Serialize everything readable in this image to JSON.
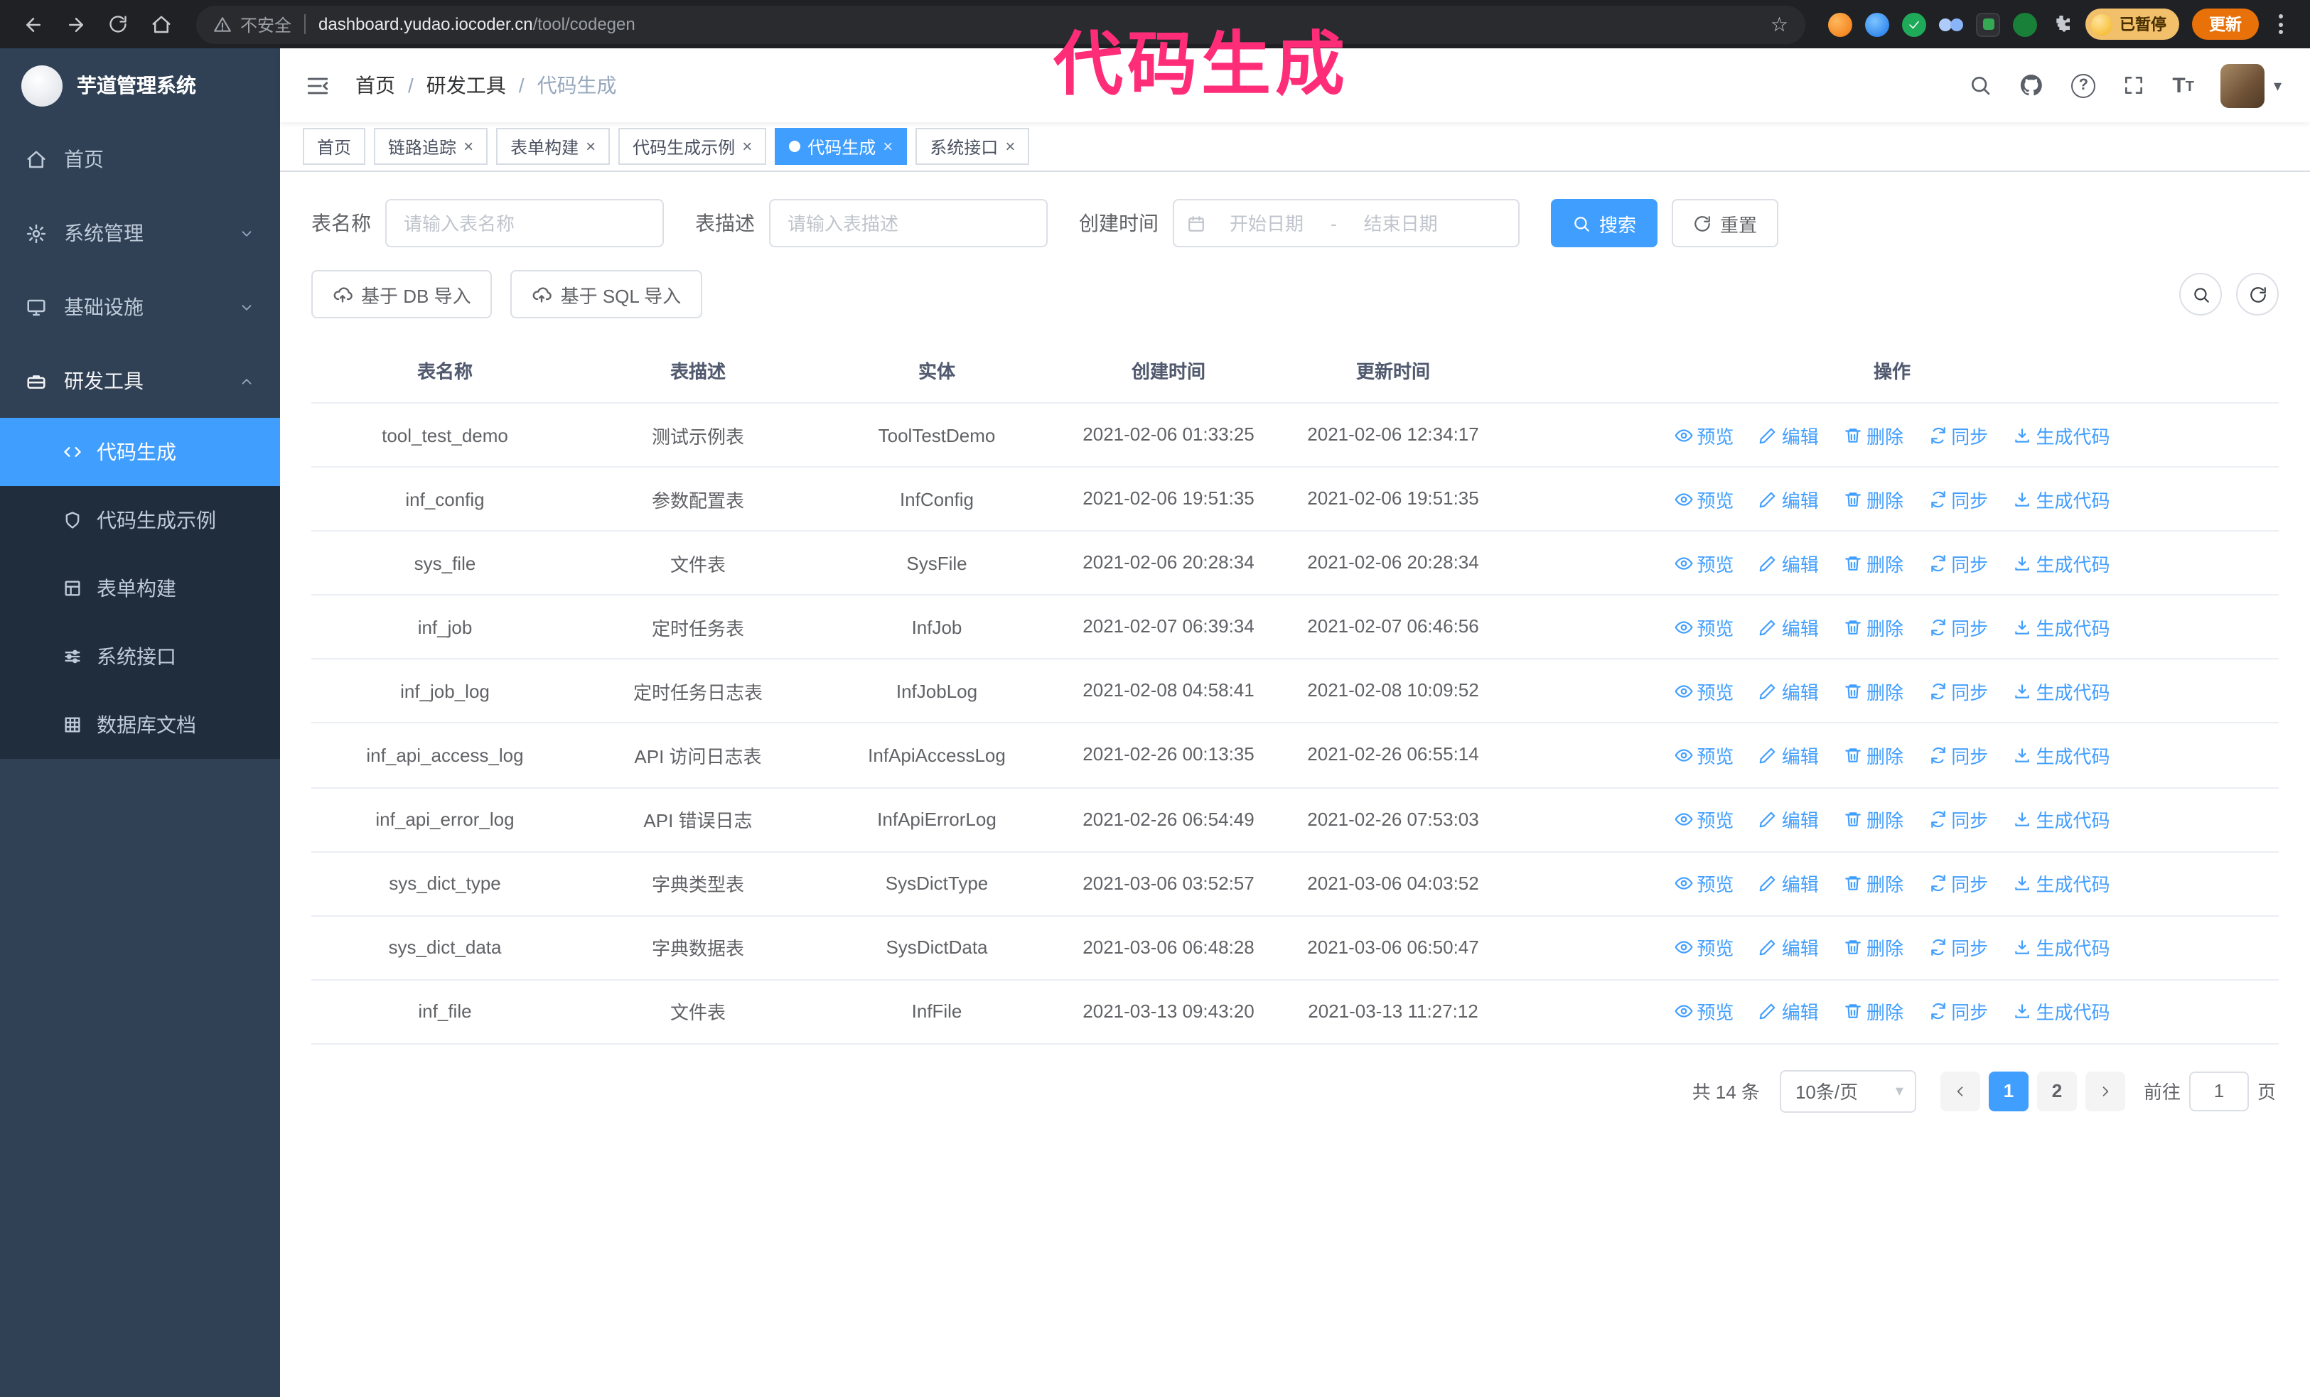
{
  "browser": {
    "security_text": "不安全",
    "url_host": "dashboard.yudao.iocoder.cn",
    "url_path": "/tool/codegen",
    "paused_badge": "已暂停",
    "update_button": "更新"
  },
  "annotation": {
    "text": "代码生成"
  },
  "colors": {
    "accent": "#409eff",
    "sidebar": "#304156",
    "submenu": "#1f2d3d",
    "annotation": "#ff2d78",
    "active_tab": "#409eff"
  },
  "sidebar": {
    "logo_title": "芋道管理系统",
    "items": [
      {
        "label": "首页"
      },
      {
        "label": "系统管理"
      },
      {
        "label": "基础设施"
      },
      {
        "label": "研发工具"
      }
    ],
    "subitems": [
      {
        "label": "代码生成",
        "active": true
      },
      {
        "label": "代码生成示例"
      },
      {
        "label": "表单构建"
      },
      {
        "label": "系统接口"
      },
      {
        "label": "数据库文档"
      }
    ]
  },
  "header": {
    "breadcrumb": [
      "首页",
      "研发工具",
      "代码生成"
    ]
  },
  "tabs": [
    {
      "label": "首页",
      "closable": false
    },
    {
      "label": "链路追踪",
      "closable": true
    },
    {
      "label": "表单构建",
      "closable": true
    },
    {
      "label": "代码生成示例",
      "closable": true
    },
    {
      "label": "代码生成",
      "closable": true,
      "active": true
    },
    {
      "label": "系统接口",
      "closable": true
    }
  ],
  "filters": {
    "table_name_label": "表名称",
    "table_name_placeholder": "请输入表名称",
    "table_desc_label": "表描述",
    "table_desc_placeholder": "请输入表描述",
    "create_time_label": "创建时间",
    "date_start_placeholder": "开始日期",
    "date_separator": "-",
    "date_end_placeholder": "结束日期",
    "search_button": "搜索",
    "reset_button": "重置"
  },
  "toolbar": {
    "import_db_button": "基于 DB 导入",
    "import_sql_button": "基于 SQL 导入"
  },
  "table": {
    "columns": [
      "表名称",
      "表描述",
      "实体",
      "创建时间",
      "更新时间",
      "操作"
    ],
    "actions": [
      "预览",
      "编辑",
      "删除",
      "同步",
      "生成代码"
    ],
    "rows": [
      {
        "name": "tool_test_demo",
        "desc": "测试示例表",
        "entity": "ToolTestDemo",
        "created": "2021-02-06 01:33:25",
        "updated": "2021-02-06 12:34:17"
      },
      {
        "name": "inf_config",
        "desc": "参数配置表",
        "entity": "InfConfig",
        "created": "2021-02-06 19:51:35",
        "updated": "2021-02-06 19:51:35"
      },
      {
        "name": "sys_file",
        "desc": "文件表",
        "entity": "SysFile",
        "created": "2021-02-06 20:28:34",
        "updated": "2021-02-06 20:28:34"
      },
      {
        "name": "inf_job",
        "desc": "定时任务表",
        "entity": "InfJob",
        "created": "2021-02-07 06:39:34",
        "updated": "2021-02-07 06:46:56"
      },
      {
        "name": "inf_job_log",
        "desc": "定时任务日志表",
        "entity": "InfJobLog",
        "created": "2021-02-08 04:58:41",
        "updated": "2021-02-08 10:09:52"
      },
      {
        "name": "inf_api_access_log",
        "desc": "API 访问日志表",
        "entity": "InfApiAccessLog",
        "created": "2021-02-26 00:13:35",
        "updated": "2021-02-26 06:55:14"
      },
      {
        "name": "inf_api_error_log",
        "desc": "API 错误日志",
        "entity": "InfApiErrorLog",
        "created": "2021-02-26 06:54:49",
        "updated": "2021-02-26 07:53:03"
      },
      {
        "name": "sys_dict_type",
        "desc": "字典类型表",
        "entity": "SysDictType",
        "created": "2021-03-06 03:52:57",
        "updated": "2021-03-06 04:03:52"
      },
      {
        "name": "sys_dict_data",
        "desc": "字典数据表",
        "entity": "SysDictData",
        "created": "2021-03-06 06:48:28",
        "updated": "2021-03-06 06:50:47"
      },
      {
        "name": "inf_file",
        "desc": "文件表",
        "entity": "InfFile",
        "created": "2021-03-13 09:43:20",
        "updated": "2021-03-13 11:27:12"
      }
    ]
  },
  "pagination": {
    "total": "共 14 条",
    "page_size": "10条/页",
    "pages": [
      "1",
      "2"
    ],
    "active_page": "1",
    "goto_prefix": "前往",
    "goto_value": "1",
    "goto_suffix": "页"
  },
  "icons": {
    "close": "×",
    "star": "☆",
    "caret": "▾",
    "separator": "/",
    "question": "?",
    "font_t": "T"
  }
}
